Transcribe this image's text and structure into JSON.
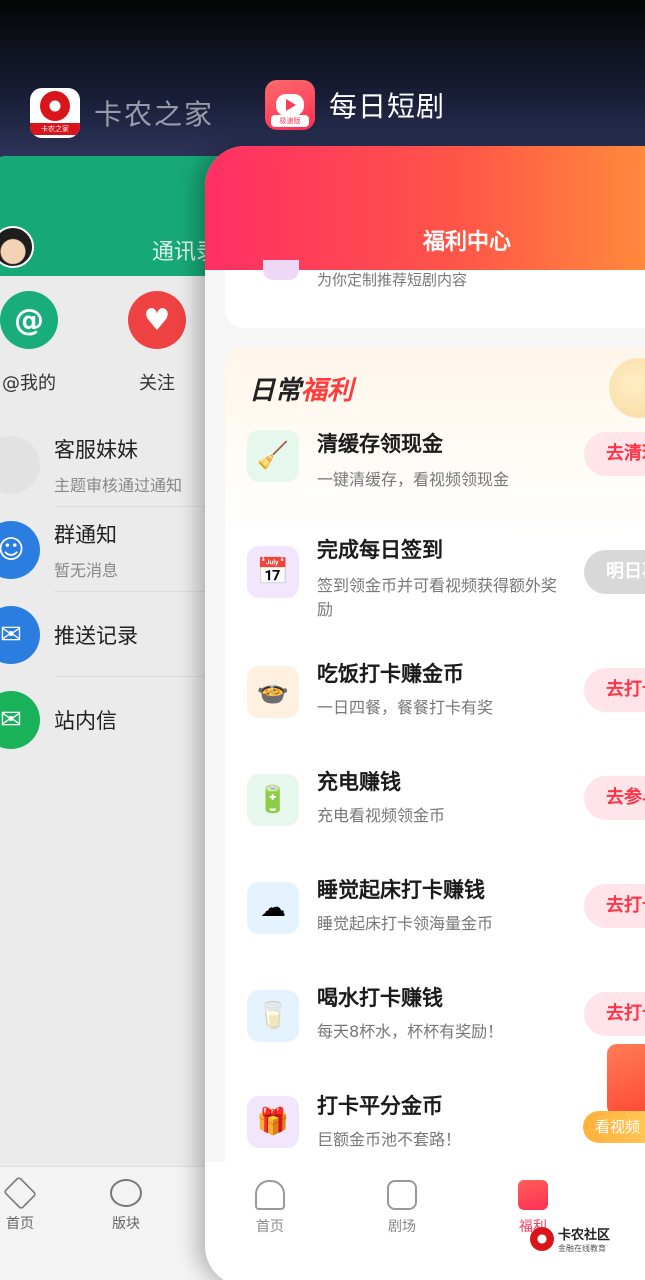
{
  "switcher": {
    "left_app": {
      "name": "卡农之家",
      "icon": "kanong-logo-icon",
      "icon_caption": "卡农之家"
    },
    "right_app": {
      "name": "每日短剧",
      "icon": "drama-tv-icon",
      "icon_badge": "极速版"
    }
  },
  "left_card": {
    "header_title": "通讯录",
    "quick_actions": [
      {
        "label": "@我的",
        "icon": "at-icon",
        "color": "#18ad7a"
      },
      {
        "label": "关注",
        "icon": "heart-plus-icon",
        "color": "#ef4242"
      }
    ],
    "messages": [
      {
        "title": "客服妹妹",
        "subtitle": "主题审核通过通知",
        "icon": "avatar-placeholder-icon",
        "color": "#e2e2e2"
      },
      {
        "title": "群通知",
        "subtitle": "暂无消息",
        "icon": "group-icon",
        "color": "#2b7de0"
      },
      {
        "title": "推送记录",
        "subtitle": "",
        "icon": "inbox-icon",
        "color": "#2b7de0"
      },
      {
        "title": "站内信",
        "subtitle": "",
        "icon": "mail-icon",
        "color": "#19b159"
      }
    ],
    "tabbar": [
      {
        "label": "首页",
        "icon": "home-diamond-icon"
      },
      {
        "label": "版块",
        "icon": "board-icon"
      }
    ]
  },
  "right_card": {
    "header_title": "福利中心",
    "promo_text": "为你定制推荐短剧内容",
    "section_title_plain": "日常",
    "section_title_accent": "福利",
    "tasks": [
      {
        "name": "清缓存领现金",
        "desc": "一键清缓存，看视频领现金",
        "button": "去清理",
        "icon": "broom-icon",
        "bg": "#e6f8ee"
      },
      {
        "name": "完成每日签到",
        "desc": "签到领金币并可看视频获得额外奖励",
        "button": "明日再来",
        "icon": "calendar-check-icon",
        "bg": "#f1e6fb"
      },
      {
        "name": "吃饭打卡赚金币",
        "desc": "一日四餐，餐餐打卡有奖",
        "button": "去打卡",
        "icon": "food-bowl-icon",
        "bg": "#fff0e0"
      },
      {
        "name": "充电赚钱",
        "desc": "充电看视频领金币",
        "button": "去参与",
        "icon": "battery-icon",
        "bg": "#e6f8ee"
      },
      {
        "name": "睡觉起床打卡赚钱",
        "desc": "睡觉起床打卡领海量金币",
        "button": "去打卡",
        "icon": "moon-cloud-icon",
        "bg": "#e4f3fd"
      },
      {
        "name": "喝水打卡赚钱",
        "desc": "每天8杯水，杯杯有奖励！",
        "button": "去打卡",
        "icon": "water-glass-icon",
        "bg": "#e4f3fd"
      },
      {
        "name": "打卡平分金币",
        "desc": "巨额金币池不套路！",
        "button": "",
        "icon": "treasure-box-icon",
        "bg": "#f1e6fb"
      }
    ],
    "watch_video_label": "看视频",
    "tabbar": [
      {
        "label": "首页",
        "icon": "home-icon",
        "active": false
      },
      {
        "label": "剧场",
        "icon": "theater-icon",
        "active": false
      },
      {
        "label": "福利",
        "icon": "welfare-icon",
        "active": true
      }
    ]
  },
  "watermark": {
    "title": "卡农社区",
    "subtitle": "金融在线教育"
  }
}
